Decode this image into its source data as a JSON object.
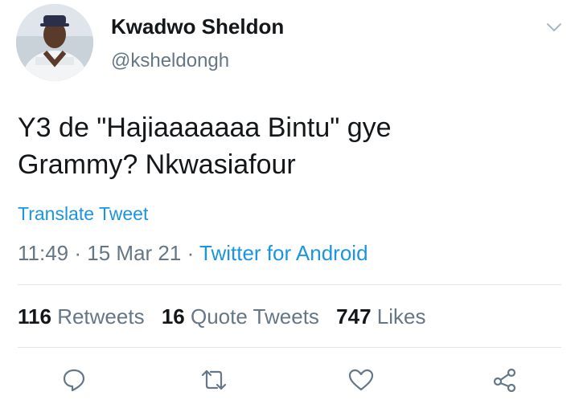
{
  "author": {
    "name": "Kwadwo Sheldon",
    "handle": "@ksheldongh"
  },
  "tweet": {
    "line1": "Y3 de \"Hajiaaaaaaa Bintu\" gye",
    "line2": "Grammy? Nkwasiafour",
    "translate_label": "Translate Tweet",
    "time": "11:49",
    "date": "15 Mar 21",
    "source": "Twitter for Android"
  },
  "stats": {
    "retweets_count": "116",
    "retweets_label": "Retweets",
    "quotes_count": "16",
    "quotes_label": "Quote Tweets",
    "likes_count": "747",
    "likes_label": "Likes"
  },
  "actions": [
    "reply-icon",
    "retweet-icon",
    "like-icon",
    "share-icon"
  ],
  "colors": {
    "link": "#1b95e0",
    "secondary_text": "#657786",
    "primary_text": "#14171a",
    "divider": "#e1e8ed"
  }
}
